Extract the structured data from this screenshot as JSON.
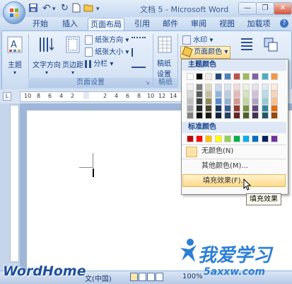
{
  "window": {
    "title": "文档 5 - Microsoft Word",
    "minimize": "—",
    "restore": "❐",
    "close": "✕"
  },
  "quick_access": {
    "undo_icon": "↶",
    "redo_icon": "↻"
  },
  "tabs": [
    "开始",
    "插入",
    "页面布局",
    "引用",
    "邮件",
    "审阅",
    "视图",
    "加载项"
  ],
  "active_tab": "页面布局",
  "ribbon": {
    "theme": {
      "label": "主题"
    },
    "page_setup": {
      "text_direction": "文字方向",
      "margins": "页边距",
      "orientation": "纸张方向",
      "size": "纸张大小",
      "columns": "分栏",
      "group_label": "页面设置"
    },
    "draft_paper": {
      "label_line1": "稿纸",
      "label_line2": "设置",
      "group_label": "稿纸"
    },
    "page_background": {
      "watermark": "水印",
      "page_color": "页面颜色"
    },
    "partial_right_1": "段落",
    "partial_right_2": "排列"
  },
  "ruler": {
    "ticks": [
      "10",
      "8",
      "6",
      "4",
      "2",
      "2",
      "4",
      "6",
      "8",
      "10",
      "12",
      "14",
      "16",
      "18"
    ]
  },
  "page_color_menu": {
    "theme_colors_header": "主题颜色",
    "standard_colors_header": "标准颜色",
    "no_color": "无颜色(N)",
    "more_colors": "其他颜色(M)...",
    "fill_effects": "填充效果(F)...",
    "tooltip": "填充效果",
    "theme_top_row": [
      "#ffffff",
      "#000000",
      "#eeece1",
      "#1f497d",
      "#4f81bd",
      "#c0504d",
      "#9bbb59",
      "#8064a2",
      "#4bacc6",
      "#f79646"
    ],
    "theme_tints": [
      [
        "#f2f2f2",
        "#7f7f7f",
        "#ddd9c3",
        "#c6d9f0",
        "#dbe5f1",
        "#f2dcdb",
        "#ebf1dd",
        "#e5e0ec",
        "#dbeef3",
        "#fdeada"
      ],
      [
        "#d8d8d8",
        "#595959",
        "#c4bd97",
        "#8db3e2",
        "#b8cce4",
        "#e5b9b7",
        "#d7e3bc",
        "#ccc1d9",
        "#b7dde8",
        "#fbd5b5"
      ],
      [
        "#bfbfbf",
        "#3f3f3f",
        "#938953",
        "#548dd4",
        "#95b3d7",
        "#d99694",
        "#c3d69b",
        "#b2a2c7",
        "#92cddc",
        "#fac08f"
      ],
      [
        "#a5a5a5",
        "#262626",
        "#494429",
        "#17365d",
        "#366092",
        "#953734",
        "#76923c",
        "#5f497a",
        "#31859b",
        "#e36c09"
      ],
      [
        "#7f7f7f",
        "#0c0c0c",
        "#1d1b10",
        "#0f243e",
        "#244061",
        "#632423",
        "#4f6128",
        "#3f3151",
        "#205867",
        "#974806"
      ]
    ],
    "standard_row": [
      "#c00000",
      "#ff0000",
      "#ffc000",
      "#ffff00",
      "#92d050",
      "#00b050",
      "#00b0f0",
      "#0070c0",
      "#002060",
      "#7030a0"
    ]
  },
  "statusbar": {
    "language": "文(中国)",
    "zoom": "100%"
  },
  "watermarks": {
    "wordhome": "WordHome",
    "site_cn": "我爱学习",
    "site_url": "5axxw.com"
  }
}
